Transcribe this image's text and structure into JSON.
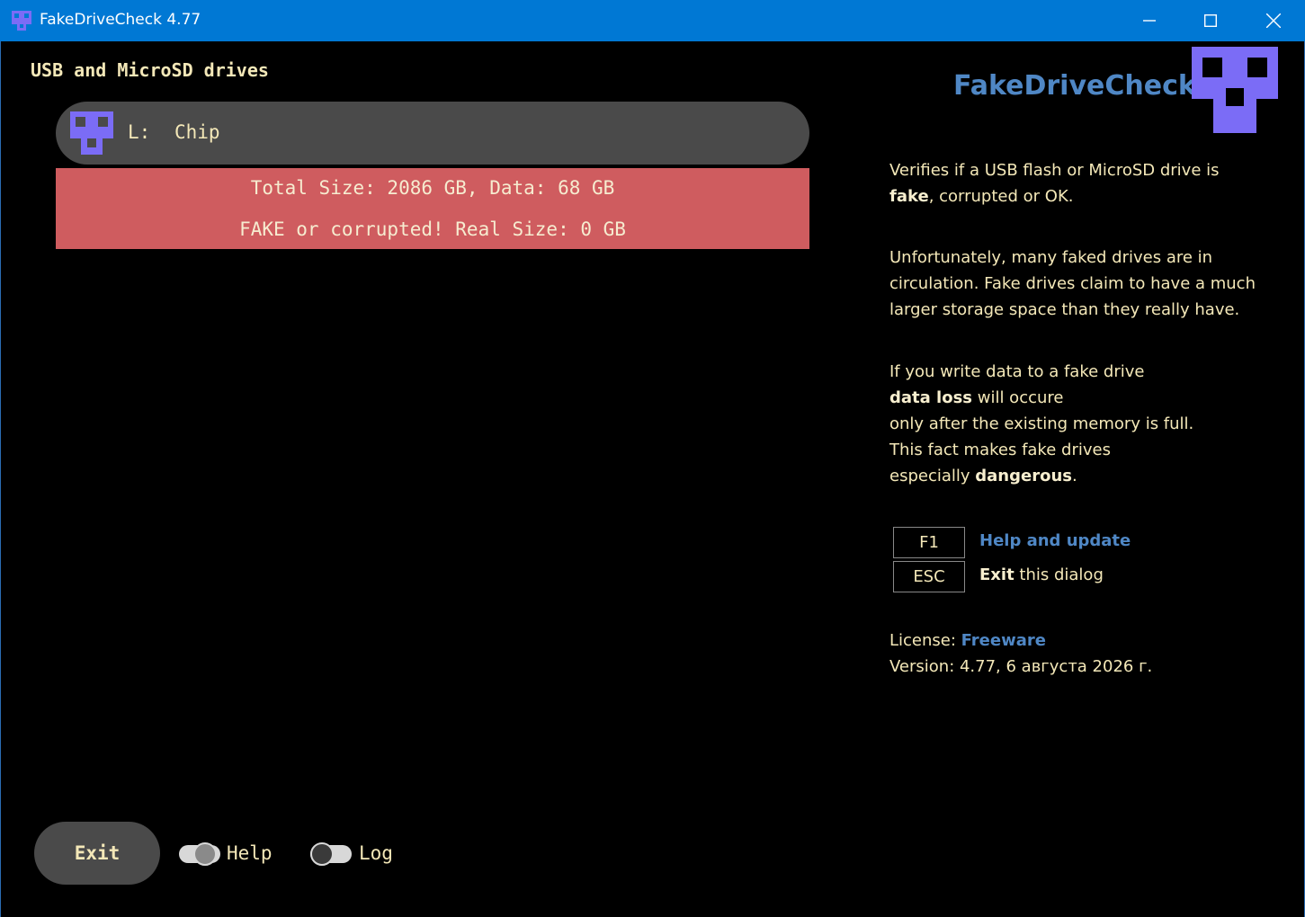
{
  "window": {
    "title": "FakeDriveCheck 4.77"
  },
  "section_title": "USB and MicroSD drives",
  "drive": {
    "letter": "L:",
    "name": "Chip"
  },
  "result": {
    "line1": "Total Size: 2086 GB, Data: 68 GB",
    "line2": "FAKE or corrupted! Real Size: 0 GB",
    "color": "#cf5c5f"
  },
  "logo": {
    "text": "FakeDriveCheck",
    "color": "#4f87c5",
    "icon_color": "#7b6cf6"
  },
  "info": {
    "p1_line1": "Verifies if a USB flash or MicroSD drive is",
    "p1_bold": "fake",
    "p1_rest": ", corrupted or OK.",
    "p2": "Unfortunately, many faked drives are in circulation. Fake drives claim to have a much larger storage space than they really have.",
    "p3_line1": "If you write data to a fake drive",
    "p3_bold1": "data loss",
    "p3_line2_rest": " will occure",
    "p3_line3": "only after the existing memory is full.",
    "p3_line4": "This fact makes fake drives",
    "p3_line5_pre": "especially ",
    "p3_bold2": "dangerous",
    "p3_line5_post": "."
  },
  "shortcuts": {
    "f1_key": "F1",
    "f1_label": "Help and update",
    "esc_key": "ESC",
    "esc_bold": "Exit",
    "esc_rest": " this dialog"
  },
  "license": {
    "label": "License: ",
    "value": "Freeware"
  },
  "version": "Version: 4.77, 6 августа 2026 г.",
  "footer": {
    "exit_label": "Exit",
    "help_label": "Help",
    "log_label": "Log",
    "help_toggle_on": true,
    "log_toggle_on": false
  },
  "icons": [
    "app-logo-icon",
    "minimize-icon",
    "maximize-icon",
    "close-icon",
    "drive-icon",
    "logo-icon"
  ]
}
